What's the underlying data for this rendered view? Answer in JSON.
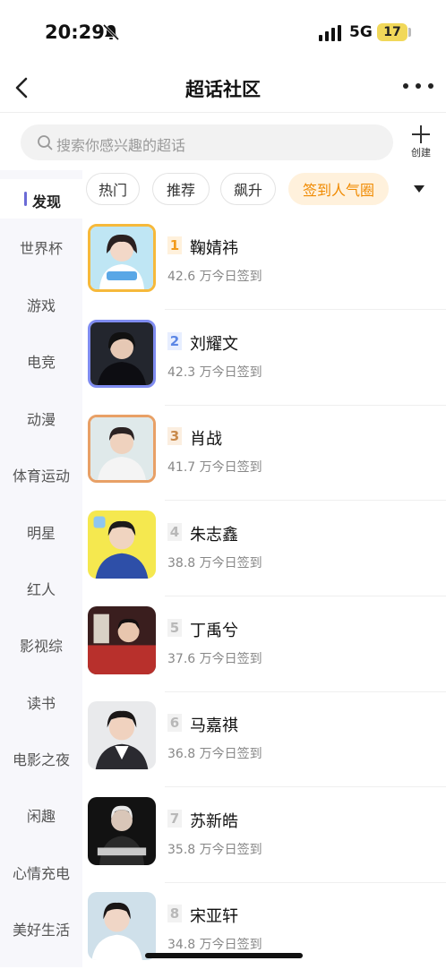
{
  "status_bar": {
    "time": "20:29",
    "network": "5G",
    "battery": "17"
  },
  "nav": {
    "title": "超话社区"
  },
  "search": {
    "placeholder": "搜索你感兴趣的超话",
    "create_label": "创建"
  },
  "sidebar": {
    "active": "发现",
    "items": [
      "世界杯",
      "游戏",
      "电竞",
      "动漫",
      "体育运动",
      "明星",
      "红人",
      "影视综",
      "读书",
      "电影之夜",
      "闲趣",
      "心情充电",
      "美好生活"
    ]
  },
  "chips": [
    {
      "label": "热门",
      "active": false
    },
    {
      "label": "推荐",
      "active": false
    },
    {
      "label": "飙升",
      "active": false
    },
    {
      "label": "签到人气圈",
      "active": true
    }
  ],
  "colors": {
    "accent": "#f08a00",
    "rank1": "#f29a1a",
    "rank2": "#5b86e5",
    "rank3": "#c98a4b",
    "rank_other": "#b8b8b8"
  },
  "rankings": [
    {
      "rank": "1",
      "name": "鞠婧祎",
      "count": "42.6 万今日签到",
      "frame": "#f6b93b"
    },
    {
      "rank": "2",
      "name": "刘耀文",
      "count": "42.3 万今日签到",
      "frame": "#7f8cf0"
    },
    {
      "rank": "3",
      "name": "肖战",
      "count": "41.7 万今日签到",
      "frame": "#e8a066"
    },
    {
      "rank": "4",
      "name": "朱志鑫",
      "count": "38.8 万今日签到",
      "frame": ""
    },
    {
      "rank": "5",
      "name": "丁禹兮",
      "count": "37.6 万今日签到",
      "frame": ""
    },
    {
      "rank": "6",
      "name": "马嘉祺",
      "count": "36.8 万今日签到",
      "frame": ""
    },
    {
      "rank": "7",
      "name": "苏新皓",
      "count": "35.8 万今日签到",
      "frame": ""
    },
    {
      "rank": "8",
      "name": "宋亚轩",
      "count": "34.8 万今日签到",
      "frame": ""
    }
  ]
}
